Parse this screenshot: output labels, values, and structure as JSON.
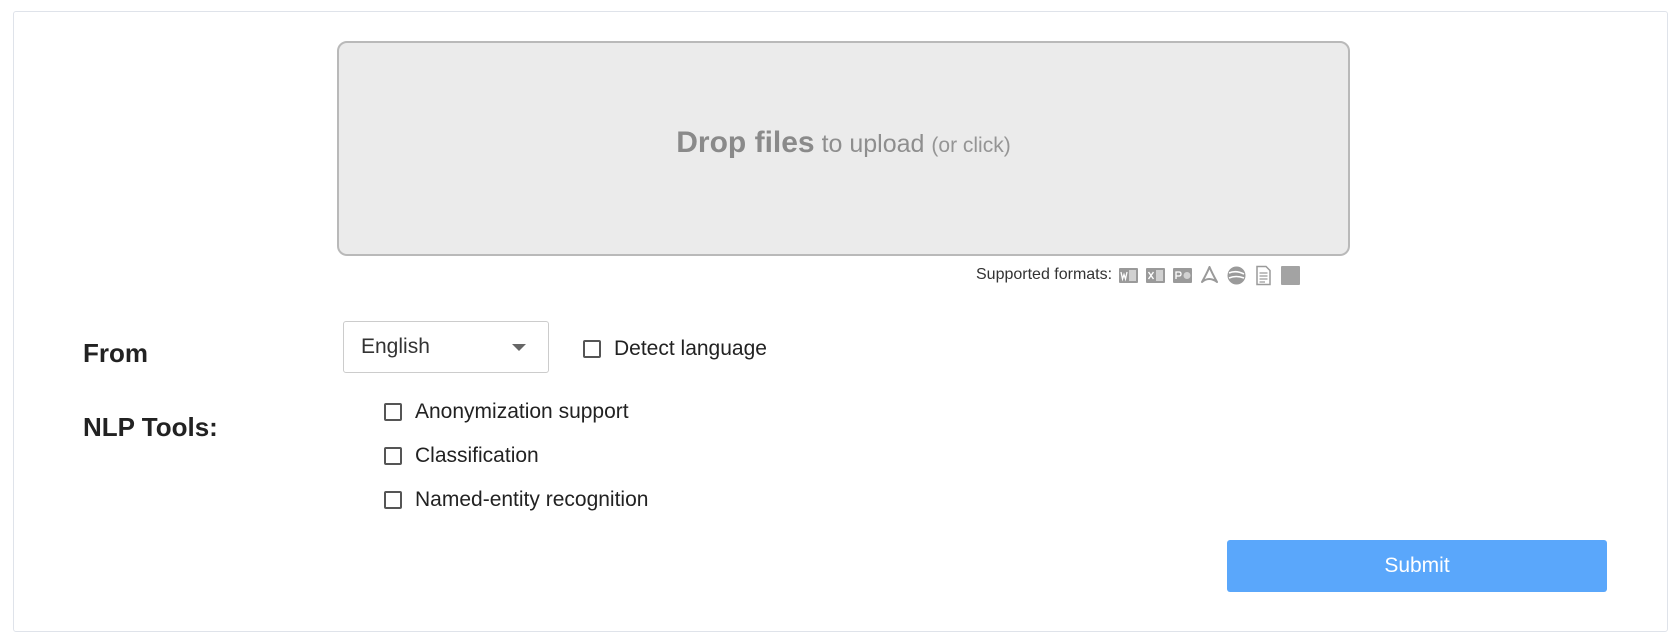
{
  "upload": {
    "drop_strong": "Drop files",
    "drop_mid": " to upload ",
    "drop_small": "(or click)",
    "formats_label": "Supported formats:",
    "format_icons": [
      "word-doc-icon",
      "excel-doc-icon",
      "powerpoint-doc-icon",
      "pdf-icon",
      "web-page-icon",
      "text-file-icon",
      "image-file-icon"
    ]
  },
  "from": {
    "label": "From",
    "selected_language": "English",
    "detect_label": "Detect language",
    "detect_checked": false
  },
  "nlp": {
    "label": "NLP Tools:",
    "options": [
      {
        "label": "Anonymization support",
        "checked": false
      },
      {
        "label": "Classification",
        "checked": false
      },
      {
        "label": "Named-entity recognition",
        "checked": false
      }
    ]
  },
  "submit": {
    "label": "Submit"
  },
  "colors": {
    "accent": "#5aa7fb",
    "dropzone_bg": "#ebebeb",
    "dropzone_border": "#b9b9b9",
    "icon_gray": "#9a9a9a"
  }
}
